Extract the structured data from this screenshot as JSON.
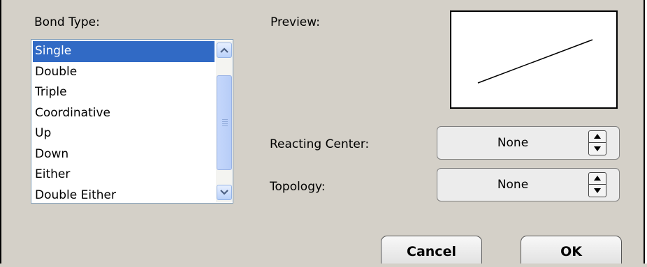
{
  "bond_type": {
    "label": "Bond Type:",
    "items": [
      "Single",
      "Double",
      "Triple",
      "Coordinative",
      "Up",
      "Down",
      "Either",
      "Double Either"
    ],
    "selected_index": 0
  },
  "preview": {
    "label": "Preview:"
  },
  "reacting_center": {
    "label": "Reacting Center:",
    "value": "None"
  },
  "topology": {
    "label": "Topology:",
    "value": "None"
  },
  "buttons": {
    "cancel": "Cancel",
    "ok": "OK"
  },
  "colors": {
    "selection": "#316ac5",
    "dialog_bg": "#d4d0c8"
  },
  "icons": {
    "scroll_up": "chevron-up-icon",
    "scroll_down": "chevron-down-icon",
    "spin_up": "triangle-up-icon",
    "spin_down": "triangle-down-icon"
  }
}
